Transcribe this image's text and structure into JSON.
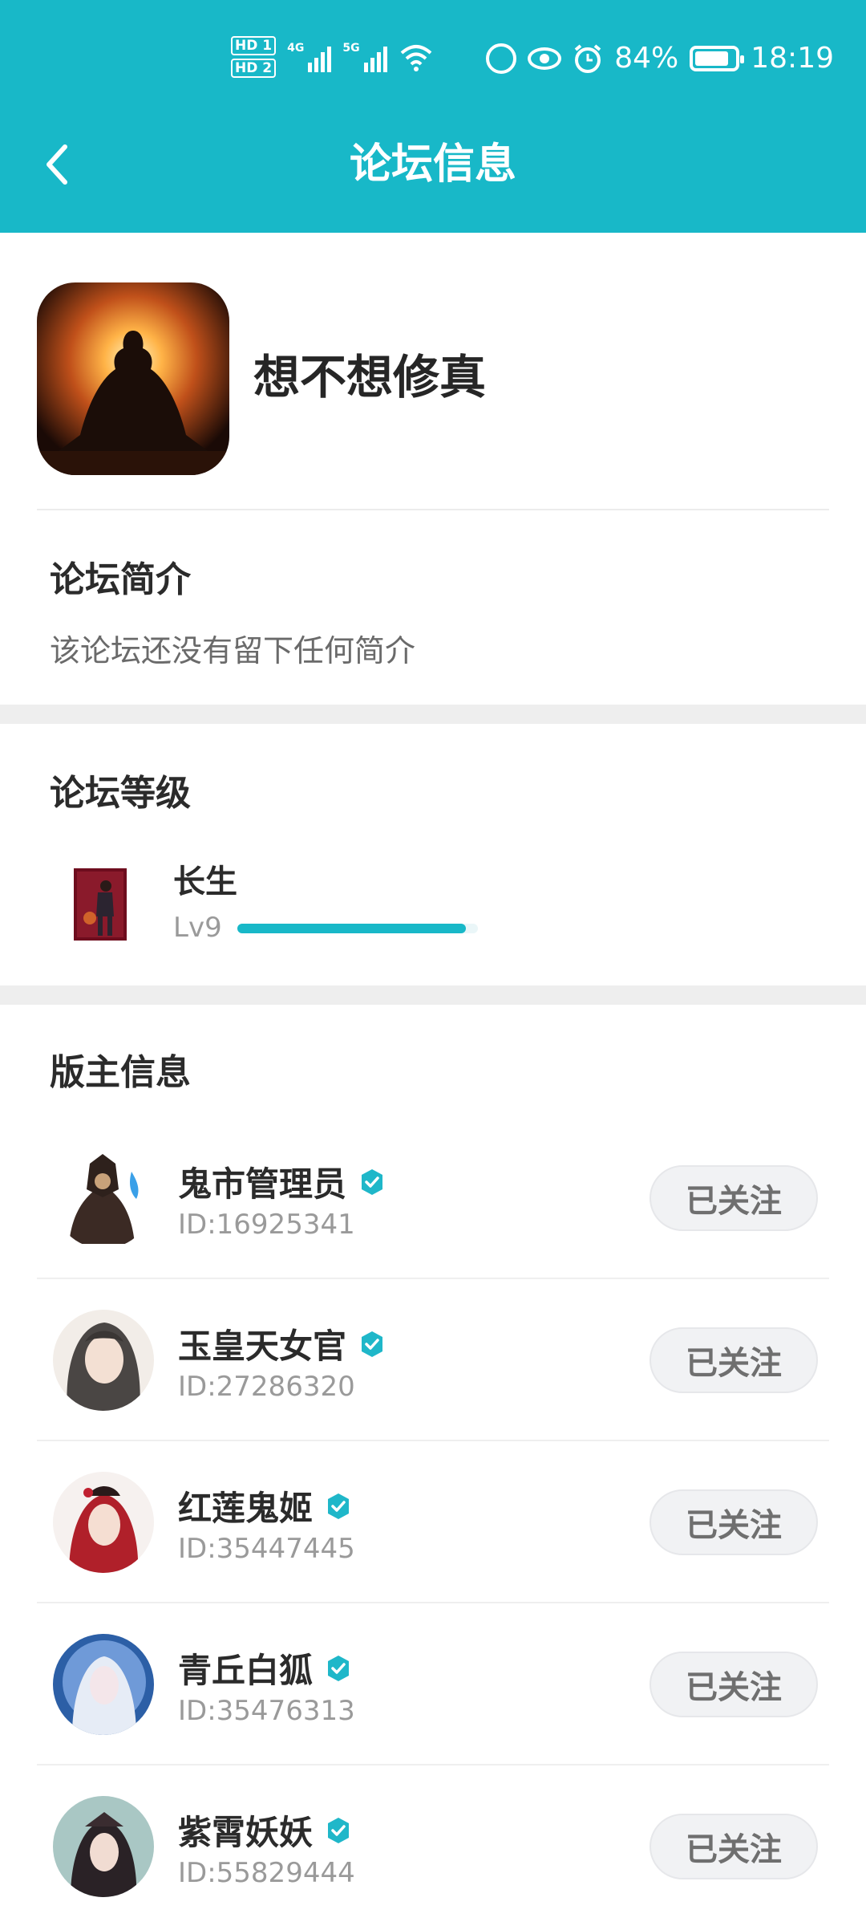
{
  "status_bar": {
    "hd1": "HD 1",
    "hd2": "HD 2",
    "net1": "4G",
    "net2": "5G",
    "battery": "84%",
    "time": "18:19"
  },
  "header": {
    "title": "论坛信息",
    "back_icon": "chevron-left-icon"
  },
  "forum": {
    "name": "想不想修真"
  },
  "intro": {
    "title": "论坛简介",
    "text": "该论坛还没有留下任何简介"
  },
  "level": {
    "title": "论坛等级",
    "name": "长生",
    "lv": "Lv9",
    "progress": 0.95
  },
  "moderators": {
    "title": "版主信息",
    "items": [
      {
        "name": "鬼市管理员",
        "id": "ID:16925341",
        "follow_label": "已关注"
      },
      {
        "name": "玉皇天女官",
        "id": "ID:27286320",
        "follow_label": "已关注"
      },
      {
        "name": "红莲鬼姬",
        "id": "ID:35447445",
        "follow_label": "已关注"
      },
      {
        "name": "青丘白狐",
        "id": "ID:35476313",
        "follow_label": "已关注"
      },
      {
        "name": "紫霄妖妖",
        "id": "ID:55829444",
        "follow_label": "已关注"
      }
    ]
  },
  "colors": {
    "accent": "#18b8c8",
    "verified": "#1fb7c9"
  }
}
